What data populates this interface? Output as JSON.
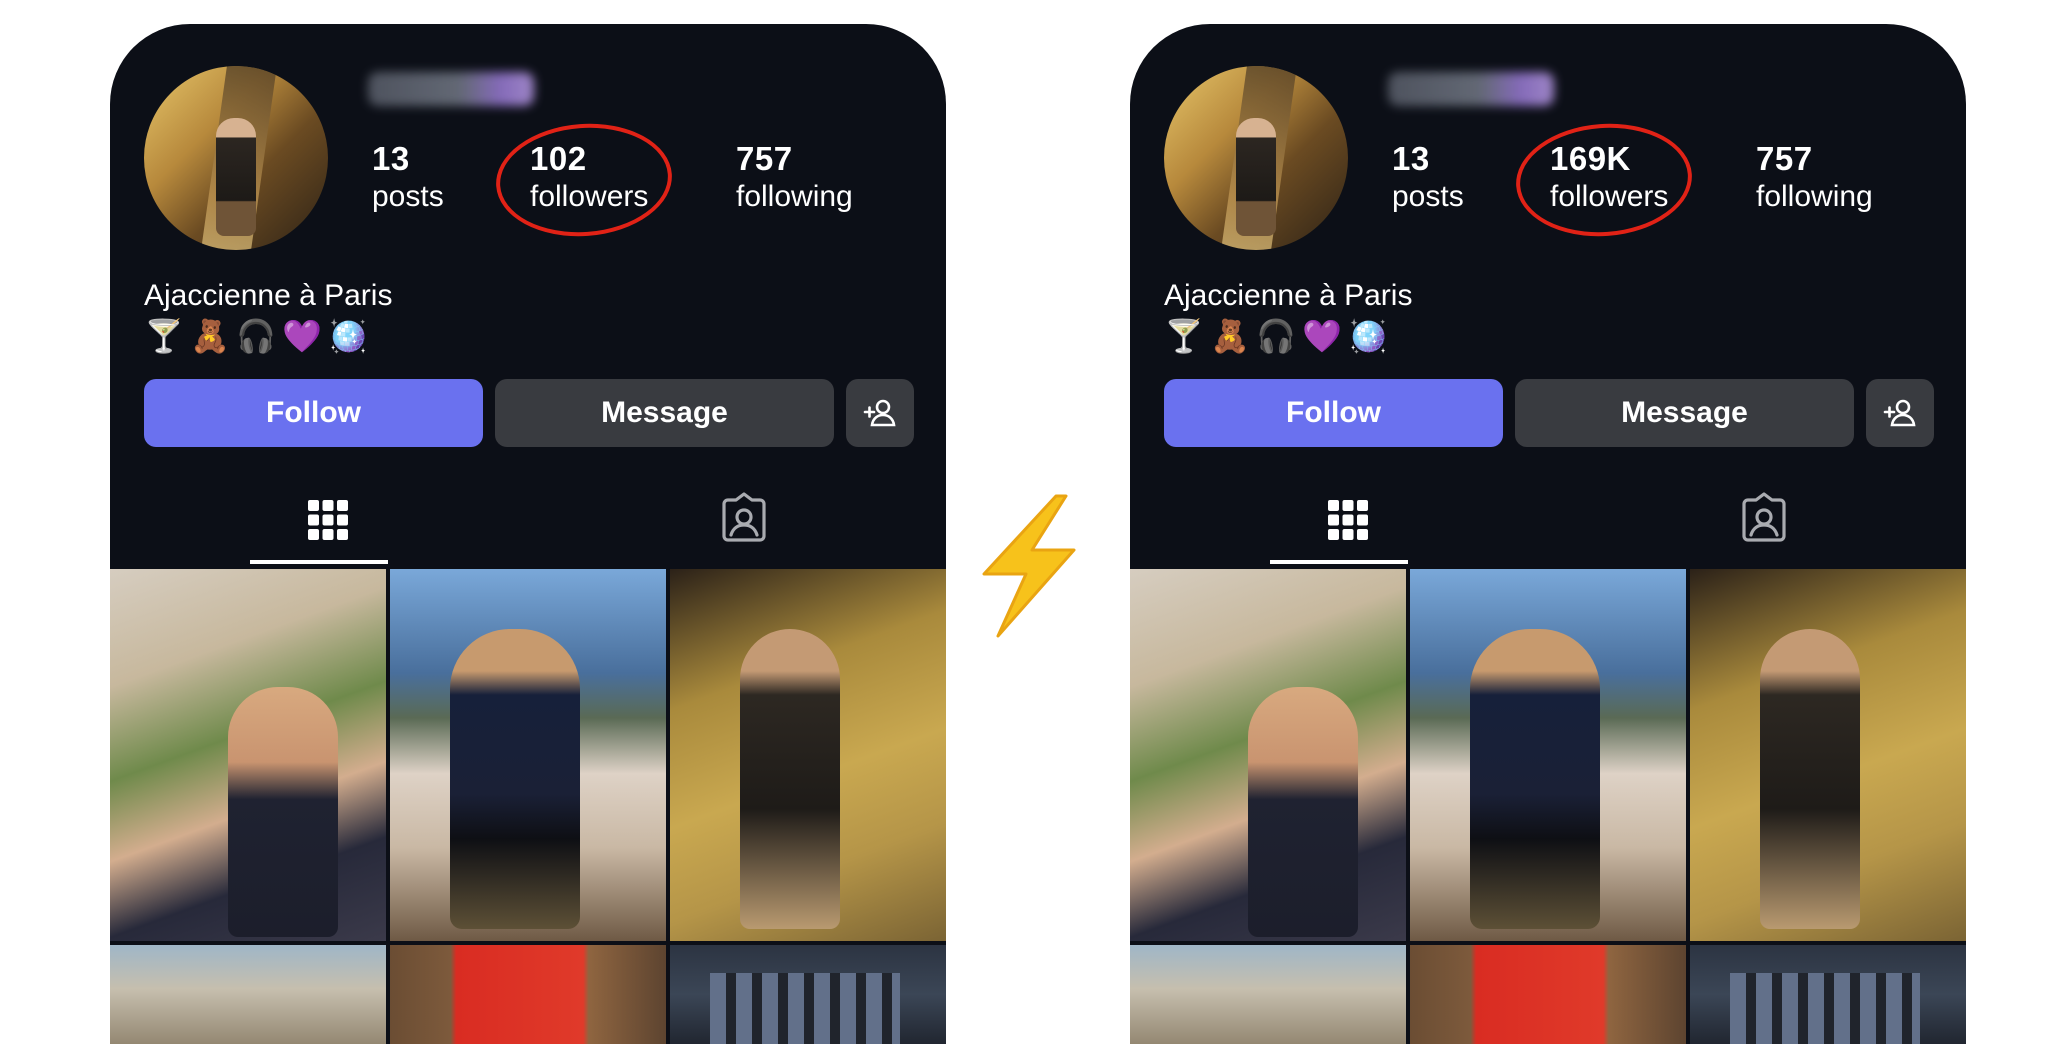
{
  "left": {
    "stats": {
      "posts_count": "13",
      "posts_label": "posts",
      "followers_count": "102",
      "followers_label": "followers",
      "following_count": "757",
      "following_label": "following"
    },
    "bio": "Ajaccienne à Paris",
    "bio_emojis": [
      "🍸",
      "🧸",
      "🎧",
      "💜",
      "🪩"
    ],
    "buttons": {
      "follow": "Follow",
      "message": "Message"
    }
  },
  "right": {
    "stats": {
      "posts_count": "13",
      "posts_label": "posts",
      "followers_count": "169K",
      "followers_label": "followers",
      "following_count": "757",
      "following_label": "following"
    },
    "bio": "Ajaccienne à Paris",
    "bio_emojis": [
      "🍸",
      "🧸",
      "🎧",
      "💜",
      "🪩"
    ],
    "buttons": {
      "follow": "Follow",
      "message": "Message"
    }
  },
  "icons": {
    "add_user": "add-person-icon",
    "grid_tab": "grid-icon",
    "tagged_tab": "tagged-person-icon",
    "separator": "lightning-icon"
  },
  "colors": {
    "background": "#0c0f17",
    "follow_button": "#6a71ef",
    "secondary_button": "#393b40",
    "highlight_circle": "#e12216",
    "lightning": "#f7c21b"
  }
}
